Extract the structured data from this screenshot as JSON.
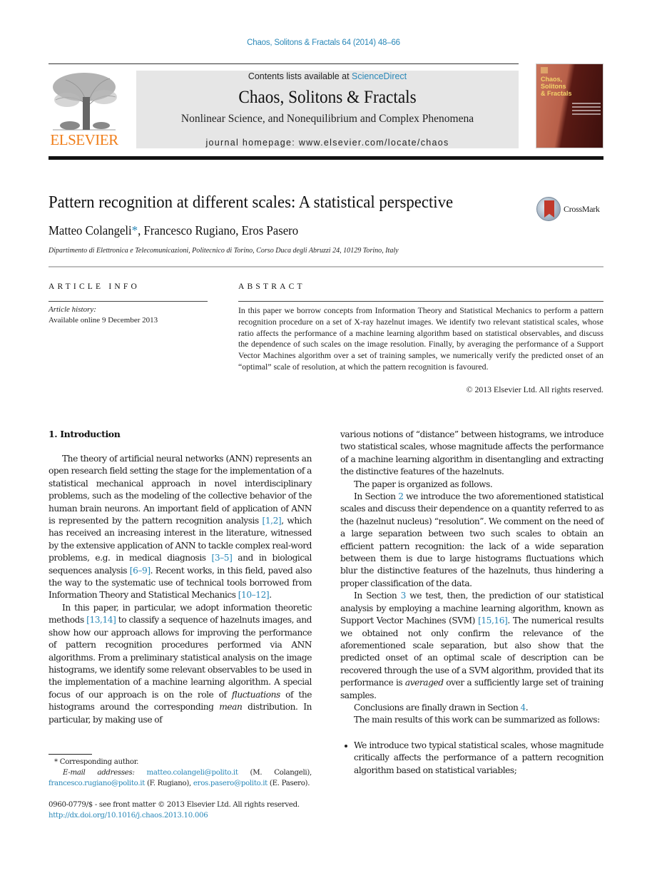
{
  "header": {
    "journal_ref": "Chaos, Solitons & Fractals 64 (2014) 48–66",
    "contents_prefix": "Contents lists available at ",
    "contents_link": "ScienceDirect",
    "journal_title": "Chaos, Solitons & Fractals",
    "journal_subtitle": "Nonlinear Science, and Nonequilibrium and Complex Phenomena",
    "homepage": "journal homepage: www.elsevier.com/locate/chaos",
    "publisher_logo": "ELSEVIER",
    "cover_title": [
      "Chaos,",
      "Solitons",
      "& Fractals"
    ],
    "crossmark_label": "CrossMark"
  },
  "article": {
    "title": "Pattern recognition at different scales: A statistical perspective",
    "authors": [
      {
        "name": "Matteo Colangeli",
        "mark": "*",
        "sep": ", "
      },
      {
        "name": "Francesco Rugiano",
        "mark": "",
        "sep": ", "
      },
      {
        "name": "Eros Pasero",
        "mark": "",
        "sep": ""
      }
    ],
    "affiliation": "Dipartimento di Elettronica e Telecomunicazioni, Politecnico di Torino, Corso Duca degli Abruzzi 24, 10129 Torino, Italy"
  },
  "article_info": {
    "label": "ARTICLE INFO",
    "history_label": "Article history:",
    "history_value": "Available online 9 December 2013"
  },
  "abstract": {
    "label": "ABSTRACT",
    "text": "In this paper we borrow concepts from Information Theory and Statistical Mechanics to perform a pattern recognition procedure on a set of X-ray hazelnut images. We identify two relevant statistical scales, whose ratio affects the performance of a machine learning algorithm based on statistical observables, and discuss the dependence of such scales on the image resolution. Finally, by averaging the performance of a Support Vector Machines algorithm over a set of training samples, we numerically verify the predicted onset of an “optimal” scale of resolution, at which the pattern recognition is favoured.",
    "copyright": "© 2013 Elsevier Ltd. All rights reserved."
  },
  "introduction": {
    "heading": "1. Introduction",
    "p1": {
      "a": "The theory of artificial neural networks (ANN) represents an open research field setting the stage for the implementation of a statistical mechanical approach in novel interdisciplinary problems, such as the modeling of the collective behavior of the human brain neurons. An important field of application of ANN is represented by the pattern recognition analysis ",
      "ref1": "[1,2]",
      "b": ", which has received an increasing interest in the literature, witnessed by the extensive application of ANN to tackle complex real-word problems, e.g. in medical diagnosis ",
      "ref2": "[3–5]",
      "c": " and in biological sequences analysis ",
      "ref3": "[6–9]",
      "d": ". Recent works, in this field, paved also the way to the systematic use of technical tools borrowed from Information Theory and Statistical Mechanics ",
      "ref4": "[10–12]",
      "e": "."
    },
    "p2": {
      "a": "In this paper, in particular, we adopt information theoretic methods ",
      "ref1": "[13,14]",
      "b": " to classify a sequence of hazelnuts images, and show how our approach allows for improving the performance of pattern recognition procedures performed via ANN algorithms. From a preliminary statistical analysis on the image histograms, we identify some relevant observables to be used in the implementation of a machine learning algorithm. A special focus of our approach is on the role of ",
      "em1": "fluctuations",
      "c": " of the histograms around the corresponding ",
      "em2": "mean",
      "d": " distribution. In particular, by making use of various notions of “distance” between histograms, we introduce two statistical scales, whose magnitude affects the performance of a machine learning algorithm in disentangling and extracting the distinctive features of the hazelnuts."
    },
    "p3": "The paper is organized as follows.",
    "p4": {
      "a": "In Section ",
      "ref1": "2",
      "b": " we introduce the two aforementioned statistical scales and discuss their dependence on a quantity referred to as the (hazelnut nucleus) “resolution”. We comment on the need of a large separation between two such scales to obtain an efficient pattern recognition: the lack of a wide separation between them is due to large histograms fluctuations which blur the distinctive features of the hazelnuts, thus hindering a proper classification of the data."
    },
    "p5": {
      "a": "In Section ",
      "ref1": "3",
      "b": " we test, then, the prediction of our statistical analysis by employing a machine learning algorithm, known as Support Vector Machines (SVM) ",
      "ref2": "[15,16]",
      "c": ". The numerical results we obtained not only confirm the relevance of the aforementioned scale separation, but also show that the predicted onset of an optimal scale of description can be recovered through the use of a SVM algorithm, provided that its performance is ",
      "em1": "averaged",
      "d": " over a sufficiently large set of training samples."
    },
    "p6": {
      "a": "Conclusions are finally drawn in Section ",
      "ref1": "4",
      "b": "."
    },
    "p7": "The main results of this work can be summarized as follows:",
    "bullets": [
      "We introduce two typical statistical scales, whose magnitude critically affects the performance of a pattern recognition algorithm based on statistical variables;"
    ]
  },
  "footnotes": {
    "star": "*",
    "corresponding": "Corresponding author.",
    "email_label": "E-mail addresses:",
    "emails": [
      {
        "address": "matteo.colangeli@polito.it",
        "who": " (M. Colangeli), "
      },
      {
        "address": "francesco.rugiano@polito.it",
        "who": " (F. Rugiano), "
      },
      {
        "address": "eros.pasero@polito.it",
        "who": " (E. Pasero)."
      }
    ],
    "issn": "0960-0779/$ - see front matter © 2013 Elsevier Ltd. All rights reserved.",
    "doi": "http://dx.doi.org/10.1016/j.chaos.2013.10.006"
  },
  "colors": {
    "link": "#2a88b8",
    "elsevier_orange": "#f07e1a",
    "masthead_bg": "#e6e6e6"
  }
}
